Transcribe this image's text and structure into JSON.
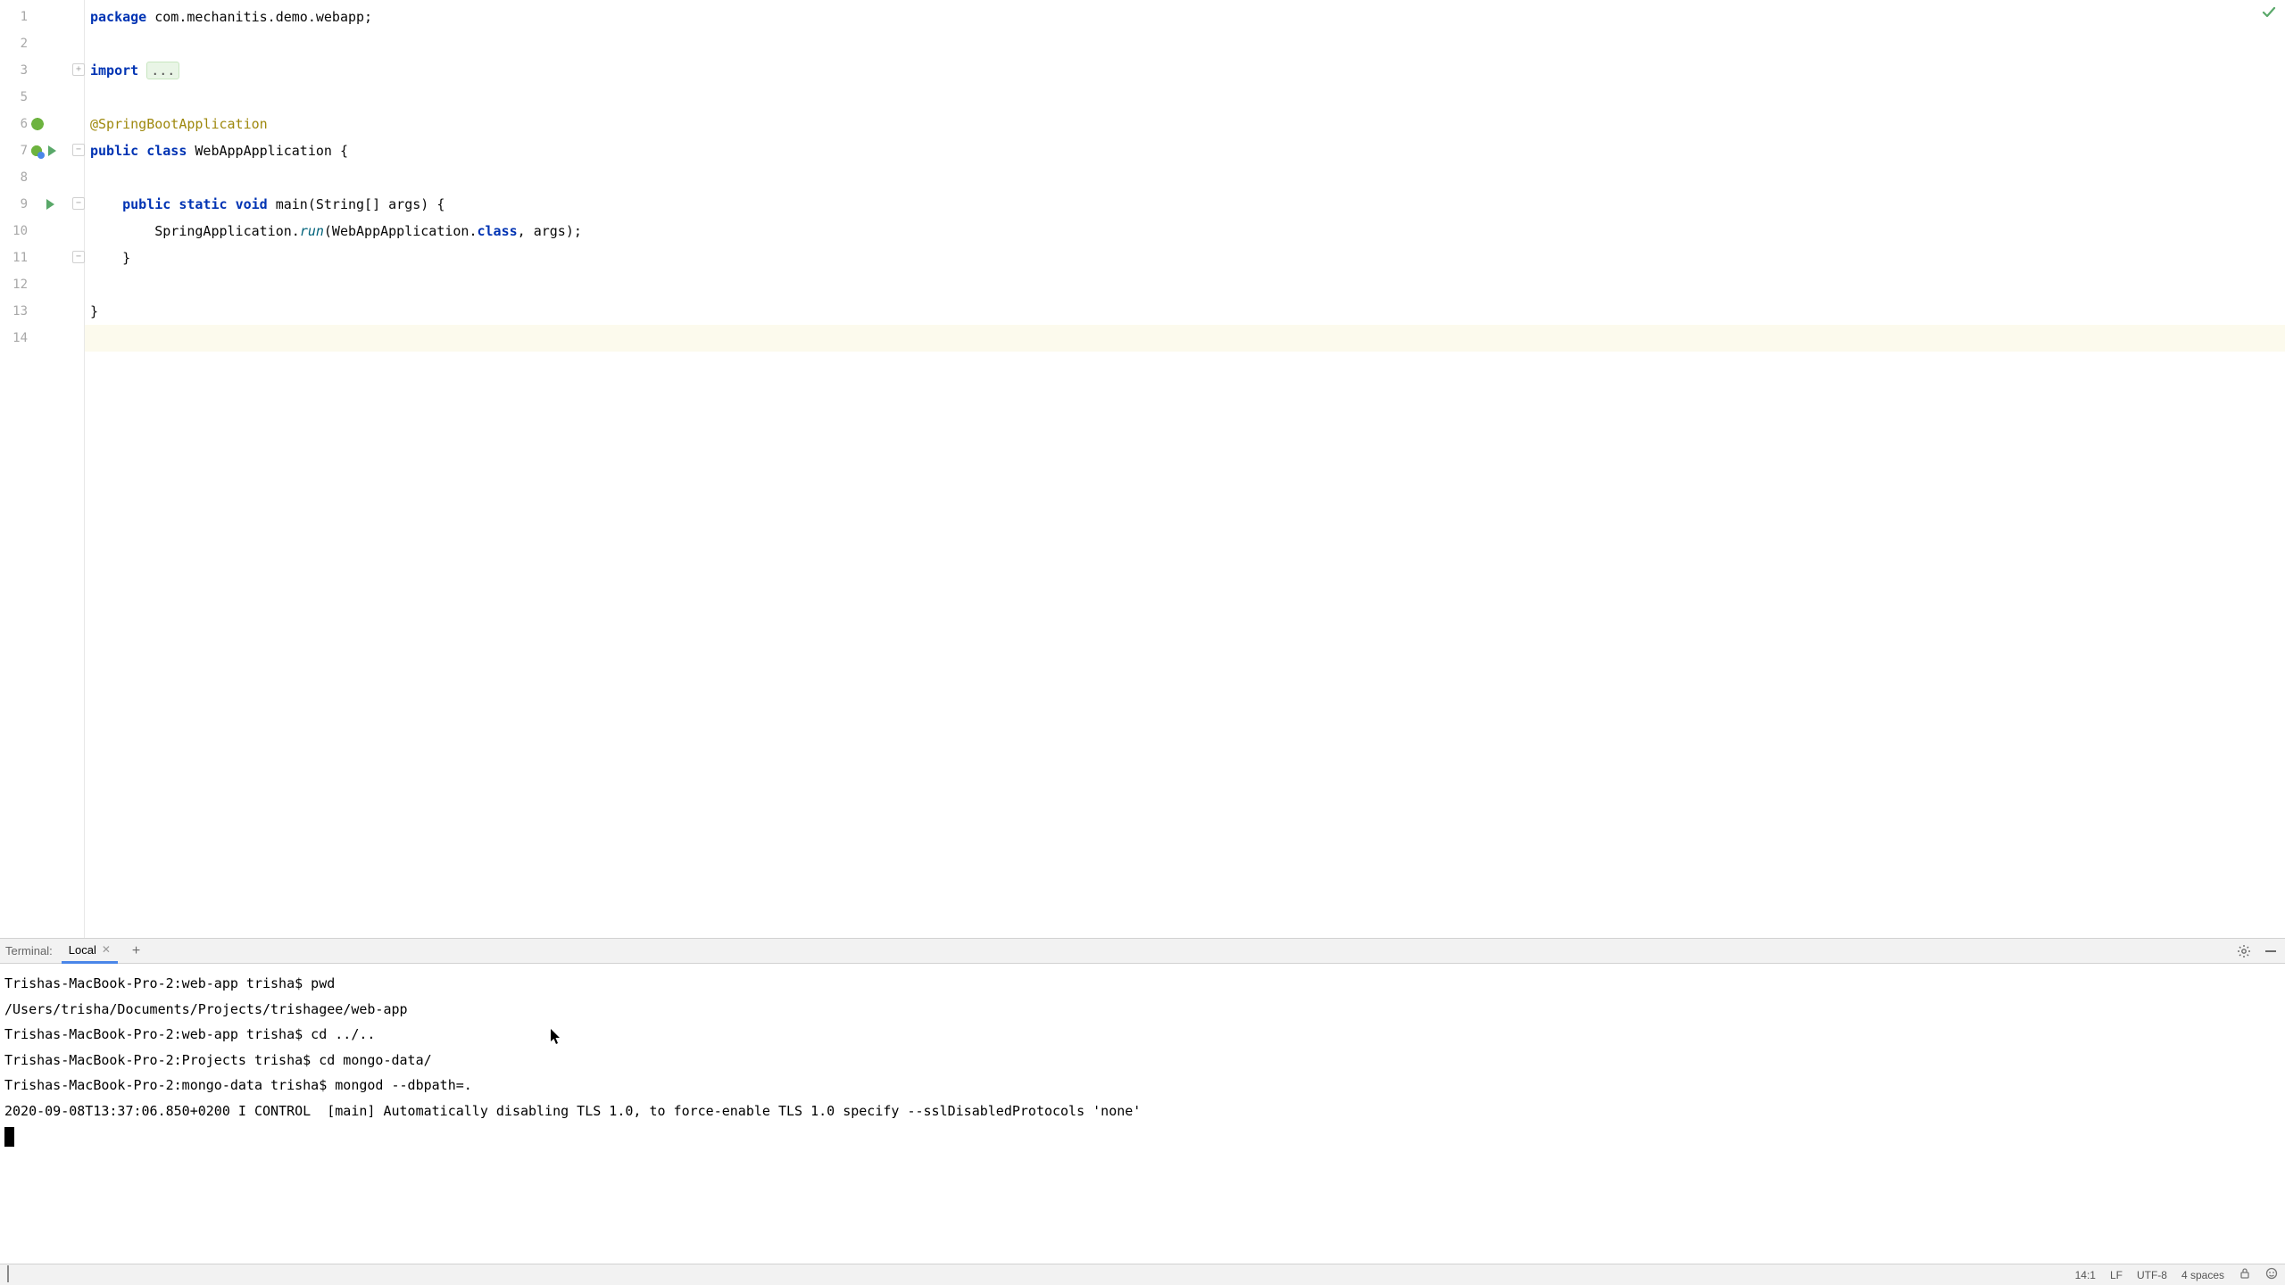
{
  "editor": {
    "lines": [
      {
        "num": "1"
      },
      {
        "num": "2"
      },
      {
        "num": "3"
      },
      {
        "num": "5"
      },
      {
        "num": "6"
      },
      {
        "num": "7"
      },
      {
        "num": "8"
      },
      {
        "num": "9"
      },
      {
        "num": "10"
      },
      {
        "num": "11"
      },
      {
        "num": "12"
      },
      {
        "num": "13"
      },
      {
        "num": "14"
      }
    ],
    "tokens": {
      "package_kw": "package",
      "package_name": " com.mechanitis.demo.webapp;",
      "import_kw": "import ",
      "import_folded": "...",
      "annotation": "@SpringBootApplication",
      "public_kw": "public",
      "class_kw": "class",
      "class_name": "WebAppApplication",
      "class_open": " {",
      "static_kw": "static",
      "void_kw": "void",
      "main_name": "main",
      "main_params": "(String[] args) {",
      "spring_app": "SpringApplication.",
      "run_mth": "run",
      "run_open": "(WebAppApplication.",
      "class_ref": "class",
      "run_rest": ", args);",
      "brace_close_inner": "}",
      "brace_close_outer": "}"
    }
  },
  "terminal": {
    "title": "Terminal:",
    "tab_label": "Local",
    "add_label": "+",
    "lines": [
      "Trishas-MacBook-Pro-2:web-app trisha$ pwd",
      "/Users/trisha/Documents/Projects/trishagee/web-app",
      "Trishas-MacBook-Pro-2:web-app trisha$ cd ../..",
      "Trishas-MacBook-Pro-2:Projects trisha$ cd mongo-data/",
      "Trishas-MacBook-Pro-2:mongo-data trisha$ mongod --dbpath=.",
      "2020-09-08T13:37:06.850+0200 I CONTROL  [main] Automatically disabling TLS 1.0, to force-enable TLS 1.0 specify --sslDisabledProtocols 'none'"
    ]
  },
  "status": {
    "caret": "14:1",
    "line_sep": "LF",
    "encoding": "UTF-8",
    "indent": "4 spaces"
  }
}
